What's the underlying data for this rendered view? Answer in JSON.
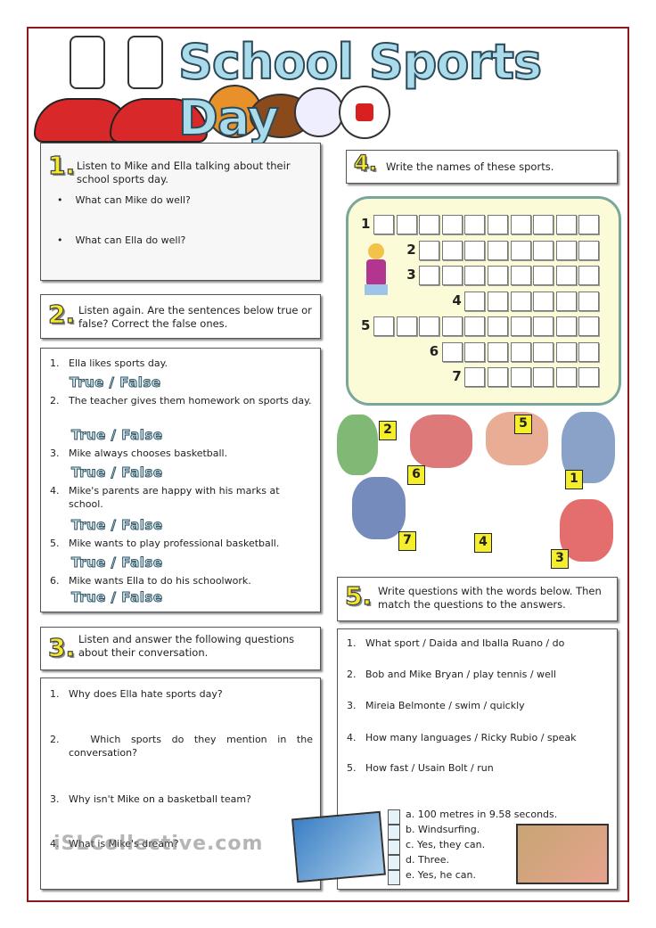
{
  "title": "School Sports Day",
  "s1": {
    "num": "1.",
    "instruction": "Listen to Mike and Ella talking about their school sports day.",
    "bullets": [
      "What can Mike do well?",
      "What can Ella do well?"
    ]
  },
  "s2": {
    "num": "2.",
    "instruction": "Listen again. Are the sentences below true or false? Correct the false ones.",
    "tf": "True / False",
    "items": [
      "Ella likes sports day.",
      "The teacher gives them homework on sports day.",
      "Mike always chooses basketball.",
      "Mike's parents are happy with his marks at school.",
      "Mike wants to play professional basketball.",
      "Mike wants Ella to do his schoolwork."
    ]
  },
  "s3": {
    "num": "3.",
    "instruction": "Listen and answer the following questions about their conversation.",
    "items": [
      "Why does Ella hate sports day?",
      "Which sports do they mention in the conversation?",
      "Why isn't Mike on a basketball team?",
      "What is Mike's dream?"
    ]
  },
  "s4": {
    "num": "4.",
    "instruction": "Write the names of these sports.",
    "rows": [
      "1",
      "2",
      "3",
      "4",
      "5",
      "6",
      "7"
    ],
    "tags": [
      "2",
      "5",
      "6",
      "1",
      "7",
      "4",
      "3"
    ]
  },
  "s5": {
    "num": "5.",
    "instruction": "Write questions with the words below. Then match the questions to the answers.",
    "items": [
      "What sport / Daida and Iballa Ruano / do",
      "Bob and Mike Bryan / play tennis / well",
      "Mireia Belmonte / swim / quickly",
      "How many languages / Ricky Rubio / speak",
      "How fast / Usain Bolt / run"
    ],
    "answers": [
      "a.  100 metres in 9.58 seconds.",
      "b.  Windsurfing.",
      "c.  Yes, they can.",
      "d.  Three.",
      "e.  Yes, he can."
    ]
  },
  "watermark": "iSLCollective.com"
}
